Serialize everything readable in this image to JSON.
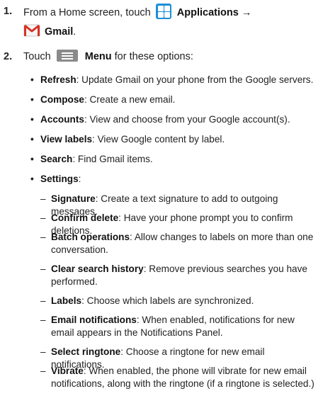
{
  "steps": [
    {
      "number": "1.",
      "line1_pre": "From a Home screen, touch",
      "line1_bold": "Applications →",
      "line2_bold": "Gmail",
      "line2_post": "."
    },
    {
      "number": "2.",
      "pre": "Touch",
      "bold": "Menu",
      "post": "for these options:"
    }
  ],
  "options": [
    {
      "bullet": "•",
      "term": "Refresh",
      "desc": ": Update Gmail on your phone from the Google servers."
    },
    {
      "bullet": "•",
      "term": "Compose",
      "desc": ": Create a new email."
    },
    {
      "bullet": "•",
      "term": "Accounts",
      "desc": ": View and choose from your Google account(s)."
    },
    {
      "bullet": "•",
      "term": "View labels",
      "desc": ": View Google content by label."
    },
    {
      "bullet": "•",
      "term": "Search",
      "desc": ": Find Gmail items."
    },
    {
      "bullet": "•",
      "term": "Settings",
      "desc": ":"
    }
  ],
  "settings": [
    {
      "dash": "–",
      "term": "Signature",
      "desc": ": Create a text signature to add to outgoing messages."
    },
    {
      "dash": "–",
      "term": "Confirm delete",
      "desc": ": Have your phone prompt you to confirm deletions."
    },
    {
      "dash": "–",
      "term": "Batch operations",
      "desc": ": Allow changes to labels on more than one conversation."
    },
    {
      "dash": "–",
      "term": "Clear search history",
      "desc": ": Remove previous searches you have performed."
    },
    {
      "dash": "–",
      "term": "Labels",
      "desc": ": Choose which labels are synchronized."
    },
    {
      "dash": "–",
      "term": "Email notifications",
      "desc": ": When enabled, notifications for new email appears in the Notifications Panel."
    },
    {
      "dash": "–",
      "term": "Select ringtone",
      "desc": ": Choose a ringtone for new email notifications."
    },
    {
      "dash": "–",
      "term": "Vibrate",
      "desc": ": When enabled, the phone will vibrate for new email notifications, along with the ringtone (if a ringtone is selected.)"
    }
  ],
  "icons": {
    "applications": "applications-grid-icon",
    "gmail": "gmail-envelope-icon",
    "menu": "menu-icon",
    "applications_color": "#1e8fd9",
    "gmail_color": "#d93025",
    "menu_color": "#8a8a8a"
  }
}
